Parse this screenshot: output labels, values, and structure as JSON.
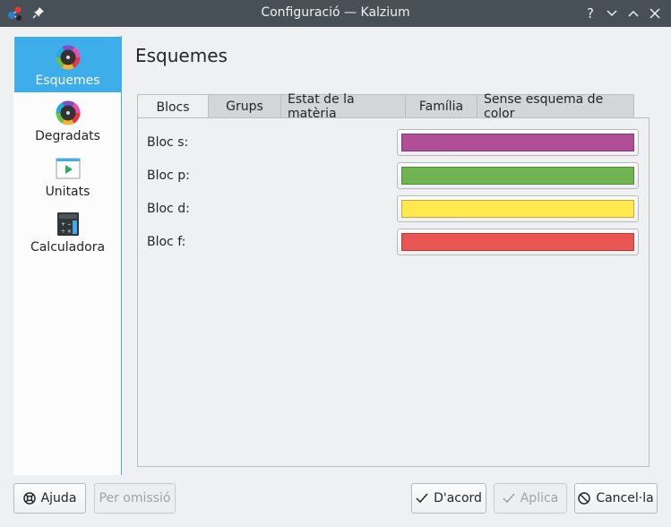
{
  "window": {
    "title": "Configuració — Kalzium",
    "help_glyph": "?",
    "minimize_glyph": "⌄",
    "maximize_glyph": "⌃",
    "close_glyph": "✕"
  },
  "sidebar": {
    "items": [
      {
        "label": "Esquemes",
        "icon": "color-wheel-icon",
        "active": true
      },
      {
        "label": "Degradats",
        "icon": "color-wheel-icon",
        "active": false
      },
      {
        "label": "Unitats",
        "icon": "video-player-icon",
        "active": false
      },
      {
        "label": "Calculadora",
        "icon": "calculator-icon",
        "active": false
      }
    ]
  },
  "page": {
    "title": "Esquemes"
  },
  "tabs": [
    {
      "label": "Blocs",
      "active": true
    },
    {
      "label": "Grups",
      "active": false
    },
    {
      "label": "Estat de la matèria",
      "active": false
    },
    {
      "label": "Família",
      "active": false
    },
    {
      "label": "Sense esquema de color",
      "active": false
    }
  ],
  "colors": [
    {
      "label": "Bloc s:",
      "color": "#b04e98"
    },
    {
      "label": "Bloc p:",
      "color": "#70b451"
    },
    {
      "label": "Bloc d:",
      "color": "#ffe94f"
    },
    {
      "label": "Bloc f:",
      "color": "#e85552"
    }
  ],
  "buttons": {
    "help": "Ajuda",
    "defaults": "Per omissió",
    "ok": "D'acord",
    "apply": "Aplica",
    "cancel": "Cancel·la"
  },
  "theme": {
    "accent": "#3daee9",
    "titlebar": "#475057"
  }
}
